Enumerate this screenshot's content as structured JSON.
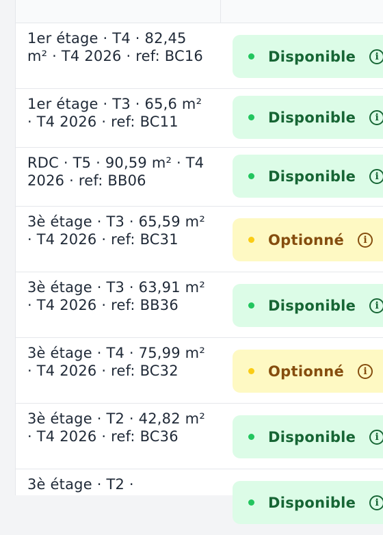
{
  "colors": {
    "available_bg": "#dcfce7",
    "available_text": "#166534",
    "available_dot": "#22c55e",
    "optioned_bg": "#fef9c3",
    "optioned_text": "#854d0e",
    "optioned_dot": "#facc15"
  },
  "rows": [
    {
      "description": "1er étage · T4 · 82,45 m² · T4 2026 · ref: BC16",
      "status": "Disponible",
      "info_icon": "info-icon"
    },
    {
      "description": "1er étage · T3 · 65,6 m² · T4 2026 · ref: BC11",
      "status": "Disponible",
      "info_icon": "info-icon"
    },
    {
      "description": "RDC · T5 · 90,59 m² · T4 2026 · ref: BB06",
      "status": "Disponible",
      "info_icon": "info-icon"
    },
    {
      "description": "3è étage · T3 · 65,59 m² · T4 2026 · ref: BC31",
      "status": "Optionné",
      "info_icon": "info-icon"
    },
    {
      "description": "3è étage · T3 · 63,91 m² · T4 2026 · ref: BB36",
      "status": "Disponible",
      "info_icon": "info-icon"
    },
    {
      "description": "3è étage · T4 · 75,99 m² · T4 2026 · ref: BC32",
      "status": "Optionné",
      "info_icon": "info-icon"
    },
    {
      "description": "3è étage · T2 · 42,82 m² · T4 2026 · ref: BC36",
      "status": "Disponible",
      "info_icon": "info-icon"
    },
    {
      "description": "3è étage · T2 ·",
      "status": "Disponible",
      "info_icon": "info-icon"
    }
  ]
}
